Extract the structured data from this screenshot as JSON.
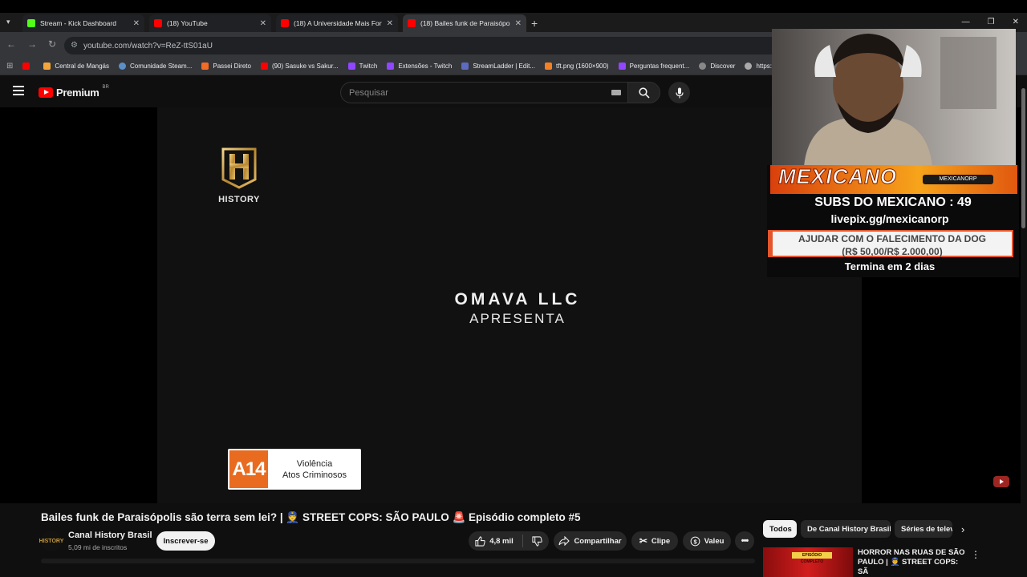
{
  "browser": {
    "tabs": [
      {
        "title": "Stream - Kick Dashboard",
        "favicon_color": "#53fc18"
      },
      {
        "title": "(18) YouTube",
        "favicon_color": "#ff0000"
      },
      {
        "title": "(18) A Universidade Mais Forte",
        "favicon_color": "#ff0000"
      },
      {
        "title": "(18) Bailes funk de Paraisópolis",
        "favicon_color": "#ff0000"
      }
    ],
    "url": "youtube.com/watch?v=ReZ-ttS01aU",
    "bookmarks": [
      {
        "label": "",
        "color": "#ff0000"
      },
      {
        "label": "Central de Mangás",
        "color": "#f4a53a"
      },
      {
        "label": "Comunidade Steam...",
        "color": "#1b2838"
      },
      {
        "label": "Passei Direto",
        "color": "#f46b25"
      },
      {
        "label": "(90) Sasuke vs Sakur...",
        "color": "#ff0000"
      },
      {
        "label": "Twitch",
        "color": "#9146ff"
      },
      {
        "label": "Extensões - Twitch",
        "color": "#9146ff"
      },
      {
        "label": "StreamLadder | Edit...",
        "color": "#5c6bc0"
      },
      {
        "label": "tft.png (1600×900)",
        "color": "#f48024"
      },
      {
        "label": "Perguntas frequent...",
        "color": "#9146ff"
      },
      {
        "label": "Discover",
        "color": "#888888"
      },
      {
        "label": "https://",
        "color": "#aaaaaa"
      }
    ]
  },
  "youtube": {
    "logo_text": "Premium",
    "region": "BR",
    "search_placeholder": "Pesquisar"
  },
  "video": {
    "history_label": "HISTORY",
    "presenter": "OMAVA LLC",
    "presents": "APRESENTA",
    "rating": "A14",
    "rating_desc_1": "Violência",
    "rating_desc_2": "Atos Criminosos",
    "title": "Bailes funk de Paraisópolis são terra sem lei? | 👮 STREET COPS: SÃO PAULO 🚨 Episódio completo #5",
    "channel": "Canal History Brasil",
    "avatar_text": "HISTORY",
    "subscribers": "5,09 mi de inscritos",
    "subscribe_label": "Inscrever-se",
    "likes": "4,8 mil",
    "share_label": "Compartilhar",
    "clip_label": "Clipe",
    "valeu_label": "Valeu"
  },
  "overlay": {
    "streamer_name": "MEXICANO",
    "social_handle": "MEXICANORP",
    "subs_text": "SUBS DO MEXICANO : 49",
    "livepix": "livepix.gg/mexicanorp",
    "goal_line1": "AJUDAR COM O FALECIMENTO DA DOG",
    "goal_line2": "(R$ 50,00/R$ 2.000,00)",
    "goal_progress": 0.025,
    "ends_in": "Termina em 2 dias"
  },
  "sidebar": {
    "chips": [
      "Todos",
      "De Canal History Brasil",
      "Séries de telev"
    ],
    "recommendation_badge": "EPISÓDIO COMPLETO",
    "recommendation_title": "HORROR NAS RUAS DE SÃO PAULO | 👮 STREET COPS: SÃ"
  },
  "colors": {
    "youtube_red": "#ff0000",
    "rating_orange": "#e86b1f",
    "overlay_orange": "#e4552b"
  }
}
